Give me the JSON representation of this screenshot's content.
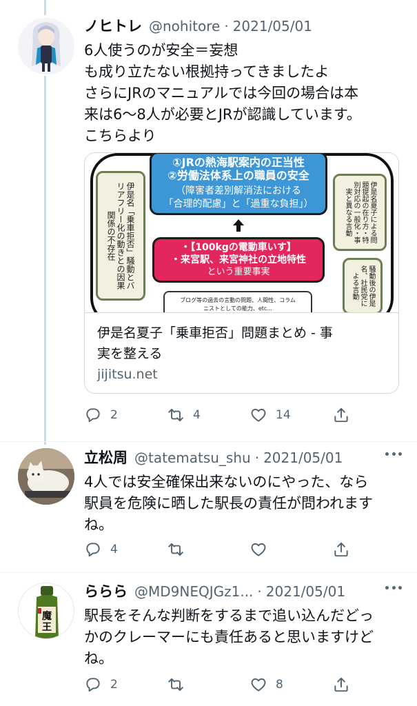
{
  "tweets": [
    {
      "name": "ノヒトレ",
      "handle": "@nohitore",
      "date": "2021/05/01",
      "text": "6人使うのが安全＝妄想\nも成り立たない根拠持ってきましたよ\nさらにJRのマニュアルでは今回の場合は本\n来は6〜8人が必要とJRが認識しています。\nこちらより",
      "card": {
        "title_line1": "伊是名夏子「乗車拒否」問題まとめ - 事",
        "title_line2": "実を整える",
        "domain": "jijitsu.net",
        "image": {
          "blue_line1": "①JRの熱海駅案内の正当性",
          "blue_line2": "②労働法体系上の職員の安全",
          "blue_line3": "（障害者差別解消法における",
          "blue_line4": "「合理的配慮」と「過重な負担」）",
          "red_line1": "・【100kgの電動車いす】",
          "red_line2": "・来宮駅、来宮神社の立地特性",
          "red_line3": "という重要事実",
          "left_box": "伊是名「乗車拒否」騒動とバリアフリー化の動きとの因果関係の不存在",
          "right_top_box": "伊是名夏子による問題提起の在り方・特別対応の一般化・事実と異なる言動",
          "right_bottom_box": "騒動後の伊是名、社民党による言動",
          "white_line1": "ブログ等の過去の言動の問題、人間性、コラム",
          "white_line2": "ニストとしての能力、etc..."
        }
      },
      "replies": "2",
      "retweets": "4",
      "likes": "14"
    },
    {
      "name": "立松周",
      "handle": "@tatematsu_shu",
      "date": "2021/05/01",
      "text": "4人では安全確保出来ないのにやった、なら\n駅員を危険に晒した駅長の責任が問われます\nね。",
      "replies": "4",
      "retweets": "",
      "likes": ""
    },
    {
      "name": "ららら",
      "handle": "@MD9NEQJGz1...",
      "date": "2021/05/01",
      "text": "駅長をそんな判断をするまで追い込んだどっ\nかのクレーマーにも責任あると思いますけど\nね。",
      "avatar_label": "魔王",
      "replies": "2",
      "retweets": "",
      "likes": "8"
    }
  ],
  "icons": {
    "reply": "reply-icon",
    "retweet": "retweet-icon",
    "like": "heart-icon",
    "share": "share-icon",
    "more": "more-icon"
  },
  "colors": {
    "secondary_text": "#536471",
    "divider": "#cfd9de",
    "primary_text": "#0f1419"
  }
}
